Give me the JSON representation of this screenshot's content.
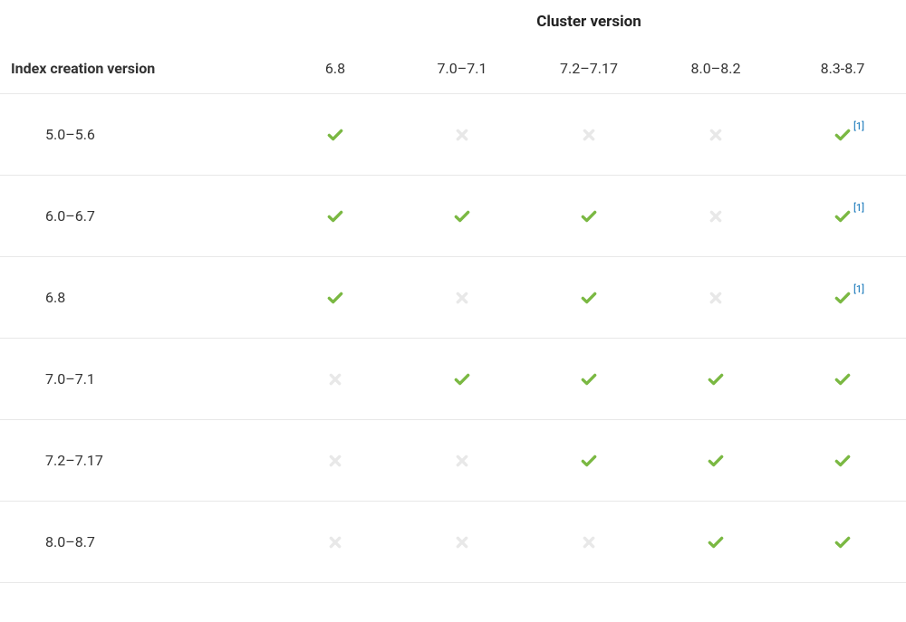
{
  "table": {
    "super_header": "Cluster version",
    "row_header_label": "Index creation version",
    "columns": [
      "6.8",
      "7.0–7.1",
      "7.2–7.17",
      "8.0–8.2",
      "8.3-8.7"
    ],
    "rows": [
      {
        "label": "5.0–5.6",
        "cells": [
          {
            "state": "yes",
            "note": ""
          },
          {
            "state": "no",
            "note": ""
          },
          {
            "state": "no",
            "note": ""
          },
          {
            "state": "no",
            "note": ""
          },
          {
            "state": "yes",
            "note": "[1]"
          }
        ]
      },
      {
        "label": "6.0–6.7",
        "cells": [
          {
            "state": "yes",
            "note": ""
          },
          {
            "state": "yes",
            "note": ""
          },
          {
            "state": "yes",
            "note": ""
          },
          {
            "state": "no",
            "note": ""
          },
          {
            "state": "yes",
            "note": "[1]"
          }
        ]
      },
      {
        "label": "6.8",
        "cells": [
          {
            "state": "yes",
            "note": ""
          },
          {
            "state": "no",
            "note": ""
          },
          {
            "state": "yes",
            "note": ""
          },
          {
            "state": "no",
            "note": ""
          },
          {
            "state": "yes",
            "note": "[1]"
          }
        ]
      },
      {
        "label": "7.0–7.1",
        "cells": [
          {
            "state": "no",
            "note": ""
          },
          {
            "state": "yes",
            "note": ""
          },
          {
            "state": "yes",
            "note": ""
          },
          {
            "state": "yes",
            "note": ""
          },
          {
            "state": "yes",
            "note": ""
          }
        ]
      },
      {
        "label": "7.2–7.17",
        "cells": [
          {
            "state": "no",
            "note": ""
          },
          {
            "state": "no",
            "note": ""
          },
          {
            "state": "yes",
            "note": ""
          },
          {
            "state": "yes",
            "note": ""
          },
          {
            "state": "yes",
            "note": ""
          }
        ]
      },
      {
        "label": "8.0–8.7",
        "cells": [
          {
            "state": "no",
            "note": ""
          },
          {
            "state": "no",
            "note": ""
          },
          {
            "state": "no",
            "note": ""
          },
          {
            "state": "yes",
            "note": ""
          },
          {
            "state": "yes",
            "note": ""
          }
        ]
      }
    ]
  }
}
